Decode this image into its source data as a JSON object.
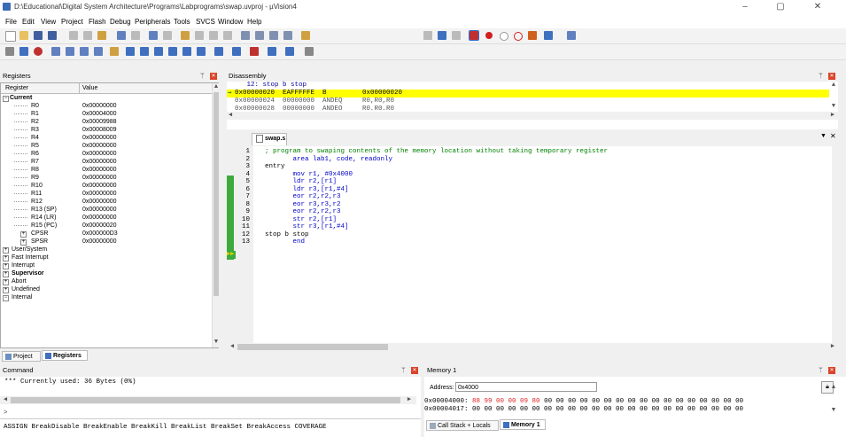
{
  "window": {
    "title": "D:\\Educational\\Digital System Architecture\\Programs\\Labprograms\\swap.uvproj - µVision4"
  },
  "menu": [
    "File",
    "Edit",
    "View",
    "Project",
    "Flash",
    "Debug",
    "Peripherals",
    "Tools",
    "SVCS",
    "Window",
    "Help"
  ],
  "registers": {
    "pane_title": "Registers",
    "col_register": "Register",
    "col_value": "Value",
    "group_current": "Current",
    "rows": [
      {
        "name": "R0",
        "value": "0x00000000"
      },
      {
        "name": "R1",
        "value": "0x00004000"
      },
      {
        "name": "R2",
        "value": "0x00009988"
      },
      {
        "name": "R3",
        "value": "0x00008009"
      },
      {
        "name": "R4",
        "value": "0x00000000"
      },
      {
        "name": "R5",
        "value": "0x00000000"
      },
      {
        "name": "R6",
        "value": "0x00000000"
      },
      {
        "name": "R7",
        "value": "0x00000000"
      },
      {
        "name": "R8",
        "value": "0x00000000"
      },
      {
        "name": "R9",
        "value": "0x00000000"
      },
      {
        "name": "R10",
        "value": "0x00000000"
      },
      {
        "name": "R11",
        "value": "0x00000000"
      },
      {
        "name": "R12",
        "value": "0x00000000"
      },
      {
        "name": "R13 (SP)",
        "value": "0x00000000"
      },
      {
        "name": "R14 (LR)",
        "value": "0x00000000"
      },
      {
        "name": "R15 (PC)",
        "value": "0x00000020"
      },
      {
        "name": "CPSR",
        "value": "0x000000D3"
      },
      {
        "name": "SPSR",
        "value": "0x00000000"
      }
    ],
    "groups": [
      "User/System",
      "Fast Interrupt",
      "Interrupt",
      "Supervisor",
      "Abort",
      "Undefined",
      "Internal"
    ],
    "tab_project": "Project",
    "tab_registers": "Registers"
  },
  "disassembly": {
    "pane_title": "Disassembly",
    "lines": [
      "     12: stop b stop",
      "0x00000020  EAFFFFFE  B         0x00000020",
      "0x00000024  00000000  ANDEQ     R0,R0,R0",
      "0x00000028  00000000  ANDEQ     R0,R0,R0"
    ]
  },
  "editor": {
    "tab": "swap.s",
    "line_numbers": [
      "1",
      "2",
      "3",
      "4",
      "5",
      "6",
      "7",
      "8",
      "9",
      "10",
      "11",
      "12",
      "13"
    ],
    "lines": [
      "; program to swaping contents of the memory location without taking temporary register",
      "       area lab1, code, readonly",
      "entry",
      "       mov r1, #0x4000",
      "       ldr r2,[r1]",
      "       ldr r3,[r1,#4]",
      "       eor r2,r2,r3",
      "       eor r3,r3,r2",
      "       eor r2,r2,r3",
      "       str r2,[r1]",
      "       str r3,[r1,#4]",
      "stop b stop",
      "       end"
    ]
  },
  "command": {
    "pane_title": "Command",
    "output": "*** Currently used: 36 Bytes (0%)",
    "prompt": ">",
    "help": "ASSIGN BreakDisable BreakEnable BreakKill BreakList BreakSet BreakAccess COVERAGE"
  },
  "memory": {
    "pane_title": "Memory 1",
    "address_label": "Address:",
    "address_value": "0x4000",
    "row1_addr": "0x00004000:",
    "row1_changed": "88 99 00 00 09 80",
    "row1_rest": "00 00 00 00 00 00 00 00 00 00 00 00 00 00 00 00 00",
    "row2": "0x00004017: 00 00 00 00 00 00 00 00 00 00 00 00 00 00 00 00 00 00 00 00 00 00 00",
    "tab_callstack": "Call Stack + Locals",
    "tab_memory": "Memory 1"
  },
  "colors": {
    "highlight": "#ffff00",
    "changed": "#e02020",
    "gutter_green": "#3cab3c",
    "close_red": "#d9442a"
  }
}
